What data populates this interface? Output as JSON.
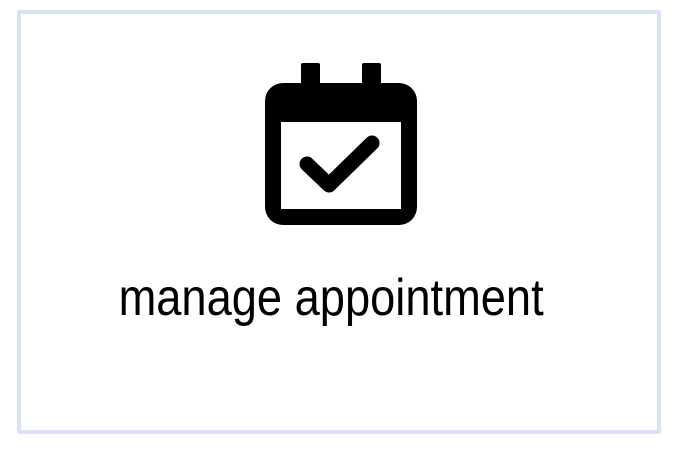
{
  "tile": {
    "label": "manage appointment",
    "icon": "calendar-check-icon",
    "border_color": "#d9e2f6",
    "icon_color": "#000000"
  }
}
